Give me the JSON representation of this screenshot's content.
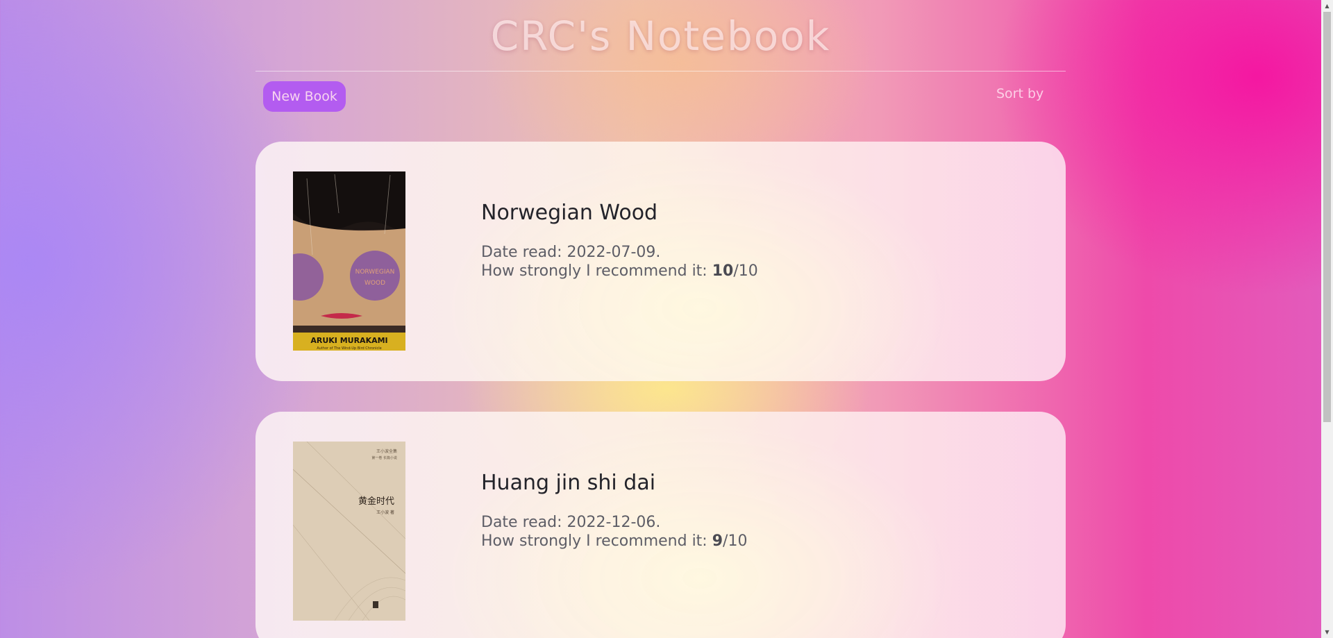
{
  "header": {
    "title": "CRC's Notebook"
  },
  "toolbar": {
    "new_book_label": "New Book",
    "sort_label": "Sort by"
  },
  "books": [
    {
      "title": "Norwegian Wood",
      "date_label": "Date read: ",
      "date": "2022-07-09",
      "date_suffix": ".",
      "recommend_label": "How strongly I recommend it: ",
      "rating": "10",
      "rating_max": "/10",
      "cover": {
        "title_text": "NORWEGIAN WOOD",
        "author_text": "ARUKI MURAKAMI",
        "tagline": "Author of The Wind-Up Bird Chronicle"
      }
    },
    {
      "title": "Huang jin shi dai",
      "date_label": "Date read: ",
      "date": "2022-12-06",
      "date_suffix": ".",
      "recommend_label": "How strongly I recommend it: ",
      "rating": "9",
      "rating_max": "/10",
      "cover": {
        "title_text": "黄金时代",
        "author_text": "王小波 著"
      }
    }
  ],
  "colors": {
    "accent_button": "#b35cf0",
    "title_text": "#23232a",
    "meta_text": "#5d5d66"
  }
}
